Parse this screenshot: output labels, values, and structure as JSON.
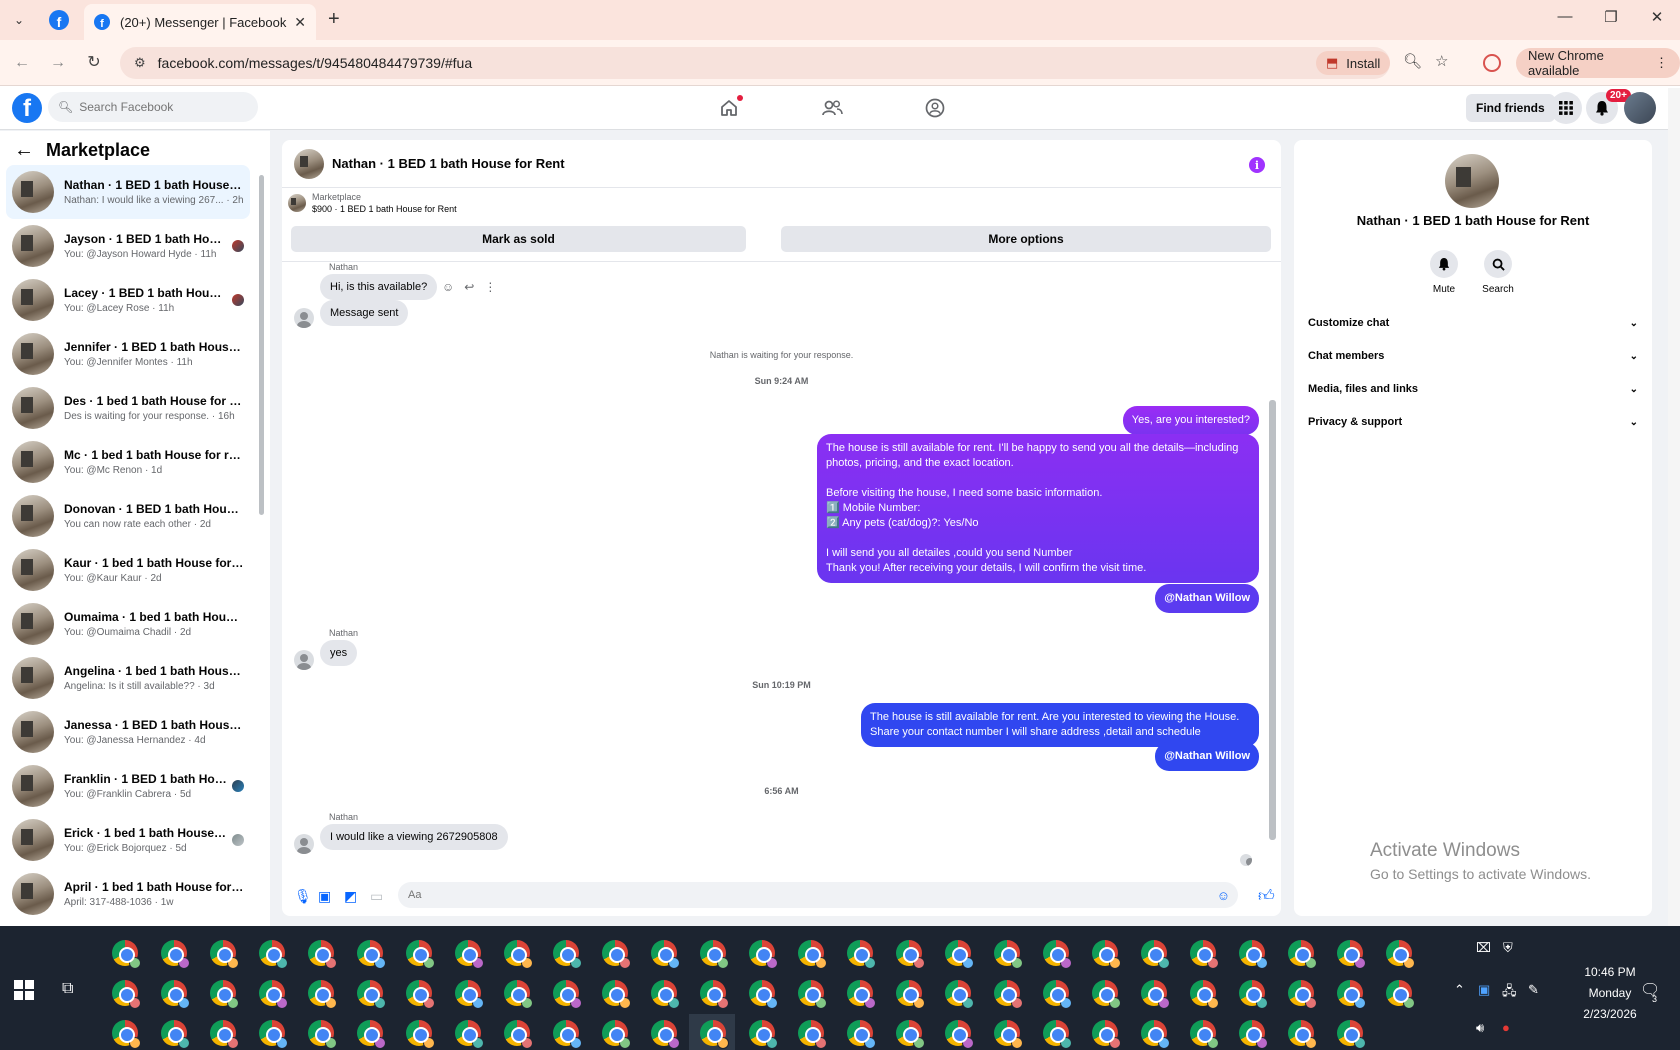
{
  "browser": {
    "tab_title": "(20+) Messenger | Facebook",
    "url": "facebook.com/messages/t/945480484479739/#fua",
    "install_label": "Install",
    "update_label": "New Chrome available"
  },
  "fb_header": {
    "search_placeholder": "Search Facebook",
    "find_friends_label": "Find friends",
    "notification_badge": "20+"
  },
  "sidebar": {
    "title": "Marketplace",
    "conversations": [
      {
        "title": "Nathan · 1 BED 1 bath House fo...",
        "subtitle": "Nathan: I would like a viewing 267... · 2h"
      },
      {
        "title": "Jayson · 1 BED 1 bath House f...",
        "subtitle": "You: @Jayson Howard Hyde · 11h"
      },
      {
        "title": "Lacey · 1 BED 1 bath House fo...",
        "subtitle": "You: @Lacey Rose · 11h"
      },
      {
        "title": "Jennifer · 1 BED 1 bath House fo...",
        "subtitle": "You: @Jennifer Montes · 11h"
      },
      {
        "title": "Des · 1 bed 1 bath House for rent",
        "subtitle": "Des is waiting for your response. · 16h"
      },
      {
        "title": "Mc · 1 bed 1 bath House for rent",
        "subtitle": "You: @Mc Renon · 1d"
      },
      {
        "title": "Donovan · 1 BED 1 bath House f...",
        "subtitle": "You can now rate each other · 2d"
      },
      {
        "title": "Kaur · 1 bed 1 bath House for rent",
        "subtitle": "You: @Kaur Kaur · 2d"
      },
      {
        "title": "Oumaima · 1 bed 1 bath House ...",
        "subtitle": "You: @Oumaima Chadil · 2d"
      },
      {
        "title": "Angelina · 1 bed 1 bath House f...",
        "subtitle": "Angelina: Is it still available?? · 3d"
      },
      {
        "title": "Janessa · 1 BED 1 bath House fo...",
        "subtitle": "You: @Janessa Hernandez · 4d"
      },
      {
        "title": "Franklin · 1 BED 1 bath House...",
        "subtitle": "You: @Franklin Cabrera · 5d"
      },
      {
        "title": "Erick · 1 bed 1 bath House for...",
        "subtitle": "You: @Erick Bojorquez · 5d"
      },
      {
        "title": "April · 1 bed 1 bath House for re...",
        "subtitle": "April: 317-488-1036 · 1w"
      }
    ]
  },
  "chat": {
    "header_name": "Nathan · 1 BED 1 bath House for Rent",
    "marketplace_label": "Marketplace",
    "listing": "$900 · 1 BED 1 bath House for Rent",
    "mark_sold_label": "Mark as sold",
    "more_options_label": "More options",
    "sender_name": "Nathan",
    "msg_available": "Hi, is this available?",
    "msg_sent": "Message sent",
    "waiting_note": "Nathan is waiting for your response.",
    "ts1": "Sun 9:24 AM",
    "out_interested": "Yes, are you interested?",
    "out_details_line1": "The house is still available for rent. I'll be happy to send you all the details—including",
    "out_details_line2": "photos, pricing, and the exact location.",
    "out_details_line3": "Before visiting the house, I need some basic information.",
    "out_details_line4": "1️⃣  Mobile Number:",
    "out_details_line5": "2️⃣ Any pets (cat/dog)?: Yes/No",
    "out_details_line6": "I will send you all detailes ,could you send Number",
    "out_details_line7": "Thank you! After receiving your details, I will confirm the visit time.",
    "mention": "@Nathan Willow",
    "msg_yes": "yes",
    "ts2": "Sun 10:19 PM",
    "out_viewing_line1": "The house is still available for rent. Are you interested to viewing  the House.",
    "out_viewing_line2": "Share your contact number I will share address ,detail and schedule",
    "ts3": "6:56 AM",
    "msg_viewing": "I would like a viewing 2672905808",
    "composer_placeholder": "Aa"
  },
  "info_panel": {
    "name": "Nathan · 1 BED 1 bath House for Rent",
    "mute_label": "Mute",
    "search_label": "Search",
    "sections": [
      "Customize chat",
      "Chat members",
      "Media, files and links",
      "Privacy & support"
    ]
  },
  "watermark": {
    "line1": "Activate Windows",
    "line2": "Go to Settings to activate Windows."
  },
  "taskbar": {
    "time": "10:46 PM",
    "day": "Monday",
    "date": "2/23/2026",
    "notification_count": "3"
  },
  "colors": {
    "fb_blue": "#1877f2",
    "messenger_purple": "#9b2cf5",
    "messenger_blue": "#3047f0",
    "notif_red": "#e41e3f"
  }
}
